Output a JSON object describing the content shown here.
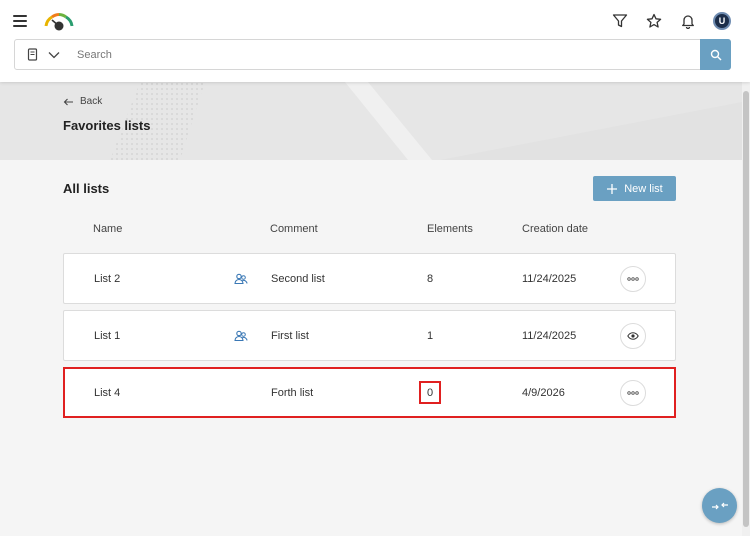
{
  "header": {
    "menu_icon": "hamburger-icon",
    "logo_icon": "gauge-logo-icon",
    "icons": [
      "filter-icon",
      "star-icon",
      "bell-icon",
      "user-avatar-icon"
    ],
    "avatar_initial": "U"
  },
  "search": {
    "type_icon": "book-icon",
    "dropdown_icon": "chevron-down-icon",
    "placeholder": "Search",
    "value": "",
    "button_icon": "search-icon"
  },
  "hero": {
    "back_label": "Back",
    "title": "Favorites lists"
  },
  "lists": {
    "section_title": "All lists",
    "new_list_label": "New list",
    "columns": {
      "name": "Name",
      "comment": "Comment",
      "elements": "Elements",
      "creation_date": "Creation date"
    },
    "rows": [
      {
        "name": "List 2",
        "shared": true,
        "comment": "Second list",
        "elements": "8",
        "date": "11/24/2025",
        "action": "more-icon"
      },
      {
        "name": "List 1",
        "shared": true,
        "comment": "First list",
        "elements": "1",
        "date": "11/24/2025",
        "action": "eye-icon"
      },
      {
        "name": "List 4",
        "shared": false,
        "comment": "Forth list",
        "elements": "0",
        "date": "4/9/2026",
        "action": "more-icon"
      }
    ]
  },
  "colors": {
    "accent": "#6aa0c2",
    "highlight": "#e02020",
    "shared_icon": "#3a78b5"
  },
  "fab_icon": "collapse-arrows-icon"
}
